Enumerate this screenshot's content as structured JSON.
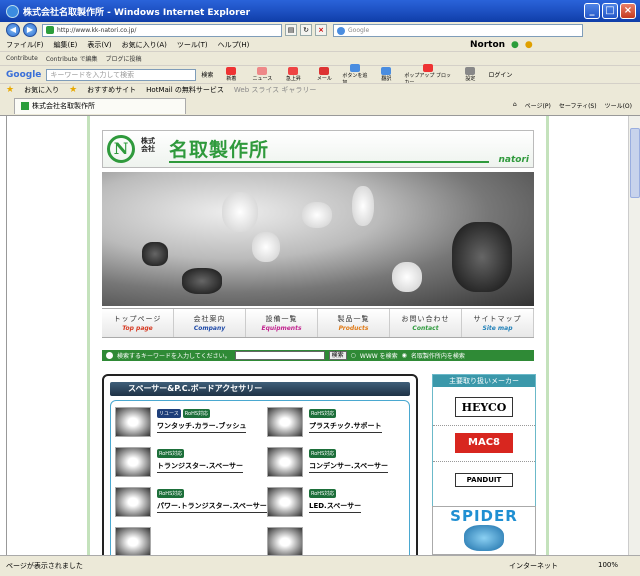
{
  "window": {
    "title": "株式会社名取製作所 - Windows Internet Explorer",
    "min": "_",
    "max": "□",
    "close": "×"
  },
  "address": {
    "url": "http://www.kk-natori.co.jp/",
    "search_placeholder": "Google"
  },
  "menu": [
    "ファイル(F)",
    "編集(E)",
    "表示(V)",
    "お気に入り(A)",
    "ツール(T)",
    "ヘルプ(H)"
  ],
  "norton": {
    "label": "Norton"
  },
  "contribute": {
    "items": [
      "Contribute",
      "Contribute で編集",
      "ブログに投稿"
    ]
  },
  "google_toolbar": {
    "logo": "Google",
    "placeholder": "キーワードを入力して検索",
    "search_label": "検索",
    "buttons": [
      "新着",
      "ニュース",
      "急上昇",
      "メール",
      "ボタンを追加",
      "翻訳",
      "ポップアップ ブロッカー",
      "設定",
      "ログイン"
    ]
  },
  "favorites": {
    "label": "お気に入り",
    "items": [
      "おすすめサイト",
      "HotMail の無料サービス",
      "Web スライス ギャラリー"
    ]
  },
  "tab": {
    "title": "株式会社名取製作所",
    "tools": [
      "ページ(P)",
      "セーフティ(S)",
      "ツール(O)"
    ]
  },
  "site": {
    "kabu": "株式\n会社",
    "name": "名取製作所",
    "brand": "natori",
    "nav": [
      {
        "jp": "トップページ",
        "en": "Top page",
        "color": "#d6361e"
      },
      {
        "jp": "会社案内",
        "en": "Company",
        "color": "#1f4aa8"
      },
      {
        "jp": "設備一覧",
        "en": "Equipments",
        "color": "#c2238f"
      },
      {
        "jp": "製品一覧",
        "en": "Products",
        "color": "#e07a16"
      },
      {
        "jp": "お問い合わせ",
        "en": "Contact",
        "color": "#2d9a3c"
      },
      {
        "jp": "サイトマップ",
        "en": "Site map",
        "color": "#1e7fb8"
      }
    ],
    "search": {
      "prompt": "検索するキーワードを入力してください。",
      "button": "検索",
      "opt_www": "WWW を検索",
      "opt_site": "名取製作所内を検索"
    },
    "category_title": "スペーサー&P.C.ボードアクセサリー",
    "products": [
      {
        "badges": [
          "リユース",
          "RoHS対応"
        ],
        "name": "ワンタッチ.カラー.ブッシュ"
      },
      {
        "badges": [
          "RoHS対応"
        ],
        "name": "プラスチック.サポート"
      },
      {
        "badges": [
          "RoHS対応"
        ],
        "name": "トランジスター.スペーサー"
      },
      {
        "badges": [
          "RoHS対応"
        ],
        "name": "コンデンサー.スペーサー"
      },
      {
        "badges": [
          "RoHS対応"
        ],
        "name": "パワー.トランジスター.スペーサー"
      },
      {
        "badges": [
          "RoHS対応"
        ],
        "name": "LED.スペーサー"
      }
    ],
    "makers_title": "主要取り扱いメーカー",
    "makers": [
      "HEYCO",
      "MAC8",
      "PANDUIT"
    ],
    "spider": "SPIDER"
  },
  "status": {
    "text": "ページが表示されました",
    "zone": "インターネット",
    "zoom": "100%"
  }
}
